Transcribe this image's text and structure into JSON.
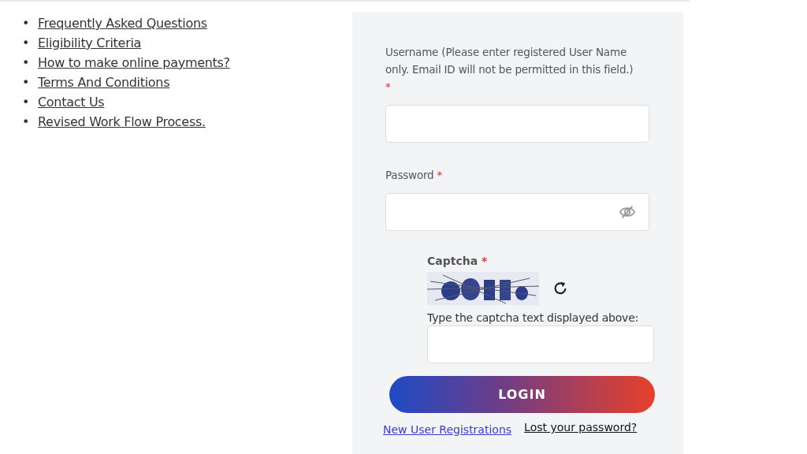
{
  "links": [
    {
      "bullet": "•",
      "label": "Frequently Asked Questions"
    },
    {
      "bullet": "•",
      "label": "Eligibility Criteria"
    },
    {
      "bullet": "•",
      "label": "How to make online payments?"
    },
    {
      "bullet": "•",
      "label": "Terms And Conditions"
    },
    {
      "bullet": "•",
      "label": "Contact Us"
    },
    {
      "bullet": "•",
      "label": "Revised Work Flow Process."
    }
  ],
  "login_form": {
    "username": {
      "label": "Username (Please enter registered User Name only. Email ID will not be permitted in this field.)",
      "required_mark": "*"
    },
    "password": {
      "label": "Password",
      "required_mark": "*",
      "visible": false
    },
    "captcha": {
      "label": "Captcha",
      "required_mark": "*",
      "prompt": "Type the captcha text displayed above:"
    },
    "login_button": "LOGIN",
    "new_user_link": "New User Registrations",
    "lost_password_link": "Lost your password?"
  }
}
